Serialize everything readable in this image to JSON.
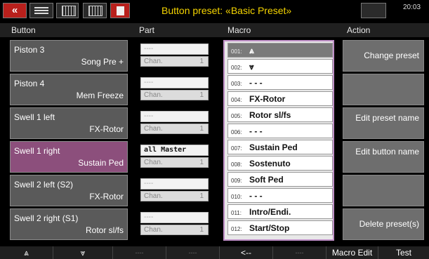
{
  "topbar": {
    "back_icon": "double-left-chevron",
    "title": "Button preset: «Basic Preset»",
    "time": "20:03",
    "accent_color": "#f5d400",
    "back_color": "#b8201c"
  },
  "columns": {
    "button": "Button",
    "part": "Part",
    "macro": "Macro",
    "action": "Action"
  },
  "buttons": [
    {
      "name": "Piston 3",
      "function": "Song Pre +",
      "selected": false
    },
    {
      "name": "Piston 4",
      "function": "Mem Freeze",
      "selected": false
    },
    {
      "name": "Swell 1 left",
      "function": "FX-Rotor",
      "selected": false
    },
    {
      "name": "Swell 1 right",
      "function": "Sustain Ped",
      "selected": true
    },
    {
      "name": "Swell 2 left   (S2)",
      "function": "FX-Rotor",
      "selected": false
    },
    {
      "name": "Swell 2 right (S1)",
      "function": "Rotor sl/fs",
      "selected": false
    }
  ],
  "parts": [
    {
      "part": "----",
      "channel": "Chan.",
      "channel_num": "1"
    },
    {
      "part": "----",
      "channel": "Chan.",
      "channel_num": "1"
    },
    {
      "part": "----",
      "channel": "Chan.",
      "channel_num": "1"
    },
    {
      "part": "all Master",
      "channel": "Chan.",
      "channel_num": "1"
    },
    {
      "part": "----",
      "channel": "Chan.",
      "channel_num": "1"
    },
    {
      "part": "----",
      "channel": "Chan.",
      "channel_num": "1"
    }
  ],
  "macros": [
    {
      "num": "001:",
      "label": "⩓",
      "selected": true
    },
    {
      "num": "002:",
      "label": "⩔",
      "selected": false
    },
    {
      "num": "003:",
      "label": "- - -",
      "selected": false
    },
    {
      "num": "004:",
      "label": "FX-Rotor",
      "selected": false
    },
    {
      "num": "005:",
      "label": "Rotor sl/fs",
      "selected": false
    },
    {
      "num": "006:",
      "label": "- - -",
      "selected": false
    },
    {
      "num": "007:",
      "label": "Sustain Ped",
      "selected": false
    },
    {
      "num": "008:",
      "label": "Sostenuto",
      "selected": false
    },
    {
      "num": "009:",
      "label": "Soft Ped",
      "selected": false
    },
    {
      "num": "010:",
      "label": "- - -",
      "selected": false
    },
    {
      "num": "011:",
      "label": "Intro/Endi.",
      "selected": false
    },
    {
      "num": "012:",
      "label": "Start/Stop",
      "selected": false
    }
  ],
  "actions": {
    "change_preset": "Change preset",
    "blank1": "",
    "edit_preset_name": "Edit preset name",
    "edit_button_name": "Edit button name",
    "blank2": "",
    "delete_presets": "Delete preset(s)"
  },
  "bottombar": {
    "up": "⩓",
    "down": "⩔",
    "empty1": "----",
    "empty2": "----",
    "back": "<--",
    "empty3": "----",
    "macro_edit": "Macro Edit",
    "test": "Test"
  }
}
